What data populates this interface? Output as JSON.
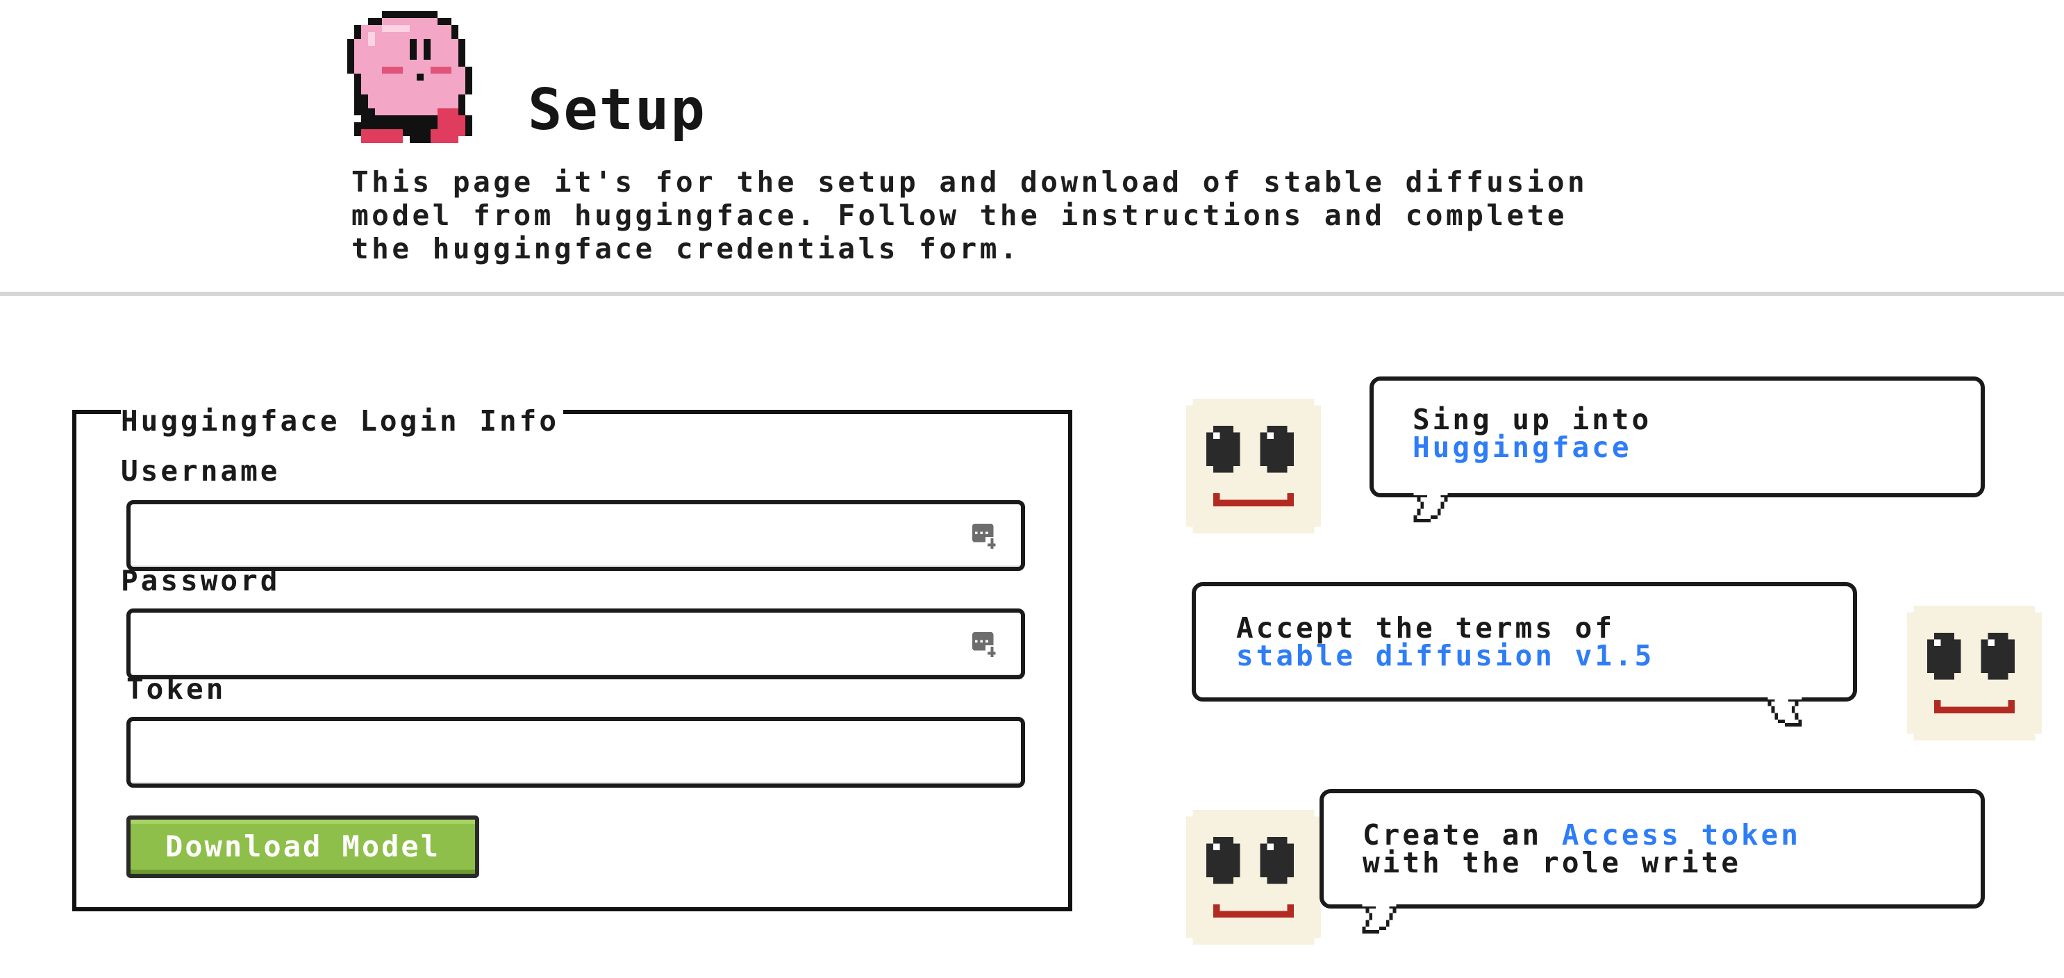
{
  "header": {
    "title": "Setup",
    "description": "This page it's for the setup and download of stable diffusion\nmodel from huggingface. Follow the instructions and complete\nthe huggingface credentials form."
  },
  "form": {
    "legend": "Huggingface Login Info",
    "username_label": "Username",
    "username_value": "",
    "password_label": "Password",
    "password_value": "",
    "token_label": "Token",
    "token_value": "",
    "submit_label": "Download Model"
  },
  "instructions": [
    {
      "text": "Sing up into",
      "link": "Huggingface",
      "suffix": ""
    },
    {
      "text": "Accept the terms of",
      "link": "stable diffusion v1.5",
      "suffix": ""
    },
    {
      "text": "Create an ",
      "link": "Access token",
      "suffix": "with the role write"
    }
  ],
  "colors": {
    "accent_button": "#8ebf4a",
    "link": "#2f7df6",
    "avatar_background": "#f7f1df",
    "avatar_mouth": "#b22a22",
    "divider": "#d6d6d6"
  },
  "icons": {
    "mascot": "pink-pixel-mascot-icon",
    "autofill": "password-manager-key-icon",
    "avatar": "smiley-face-icon"
  }
}
